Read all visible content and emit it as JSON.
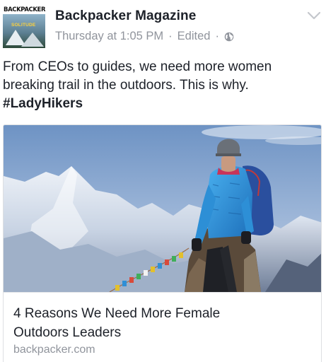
{
  "post": {
    "page_name": "Backpacker Magazine",
    "timestamp": "Thursday at 1:05 PM",
    "separator": "·",
    "edited_label": "Edited",
    "text_line1": "From CEOs to guides, we need more women",
    "text_line2": "breaking trail in the outdoors. This is why.",
    "hashtag": "#LadyHikers",
    "icons": {
      "privacy": "globe-icon",
      "options": "chevron-down-icon"
    }
  },
  "avatar": {
    "masthead": "BACKPACKER",
    "cover_word": "SOLITUDE"
  },
  "link": {
    "title_line1": "4 Reasons We Need More Female",
    "title_line2": "Outdoors Leaders",
    "domain": "backpacker.com"
  },
  "colors": {
    "text_primary": "#1d2129",
    "text_secondary": "#90949c",
    "jacket": "#2d8fd6",
    "backpack": "#2a4f9e",
    "sky": "#7f9fc8"
  }
}
